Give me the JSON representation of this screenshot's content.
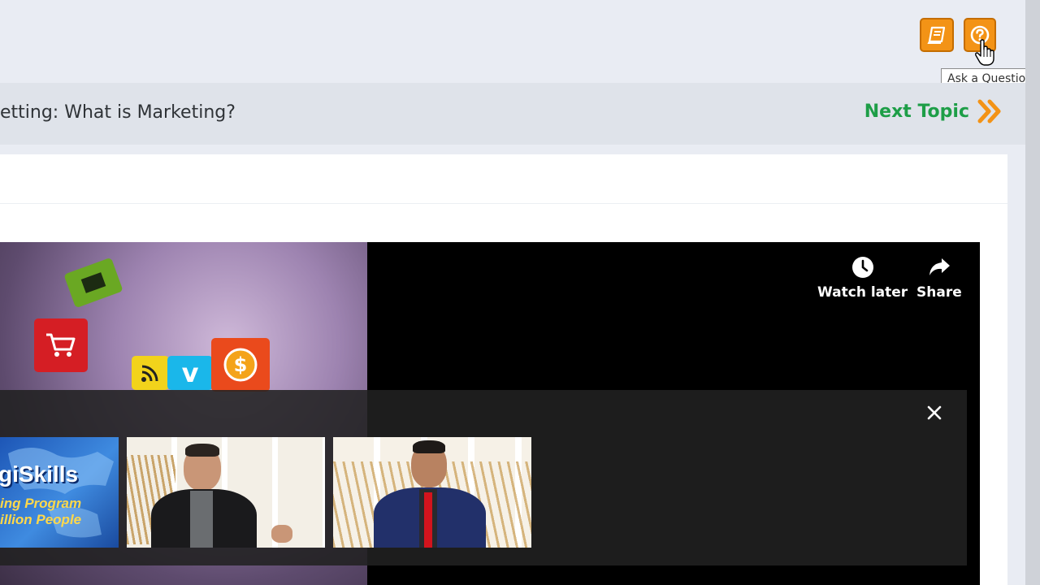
{
  "toolbar": {
    "notes_icon": "notebook-icon",
    "ask_icon": "question-circle-icon",
    "tooltip": "Ask a Question",
    "accent": "#f39316"
  },
  "topic": {
    "title": "etting: What is Marketing?",
    "next_label": "Next Topic",
    "next_color": "#1d9e47"
  },
  "video": {
    "watch_later": "Watch later",
    "share": "Share",
    "close_icon": "close-icon",
    "cards": [
      {
        "name": "digiskills-card",
        "line1": "giSkills",
        "line2": "ing Program",
        "line3": "illion People"
      },
      {
        "name": "host-interview-card-1"
      },
      {
        "name": "host-interview-card-2"
      }
    ]
  }
}
